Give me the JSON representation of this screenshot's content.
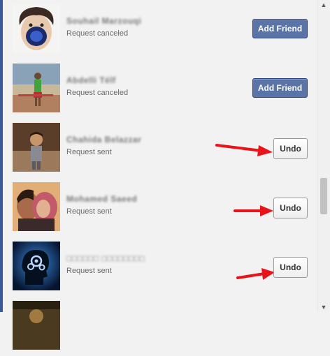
{
  "requests": [
    {
      "name": "Souhail Marzouqi",
      "status": "Request canceled",
      "button": "Add Friend",
      "button_type": "add"
    },
    {
      "name": "Abdelli Télf",
      "status": "Request canceled",
      "button": "Add Friend",
      "button_type": "add"
    },
    {
      "name": "Chahida Belazzar",
      "status": "Request sent",
      "button": "Undo",
      "button_type": "undo"
    },
    {
      "name": "Mohamed Saeed",
      "status": "Request sent",
      "button": "Undo",
      "button_type": "undo"
    },
    {
      "name": "□□□□□□ □□□□□□□□",
      "status": "Request sent",
      "button": "Undo",
      "button_type": "undo"
    }
  ],
  "scrollbar": {
    "up_icon": "▲",
    "down_icon": "▼"
  },
  "colors": {
    "add_button": "#5b74a8",
    "arrow": "#e8141a",
    "accent_border": "#3b5998"
  }
}
